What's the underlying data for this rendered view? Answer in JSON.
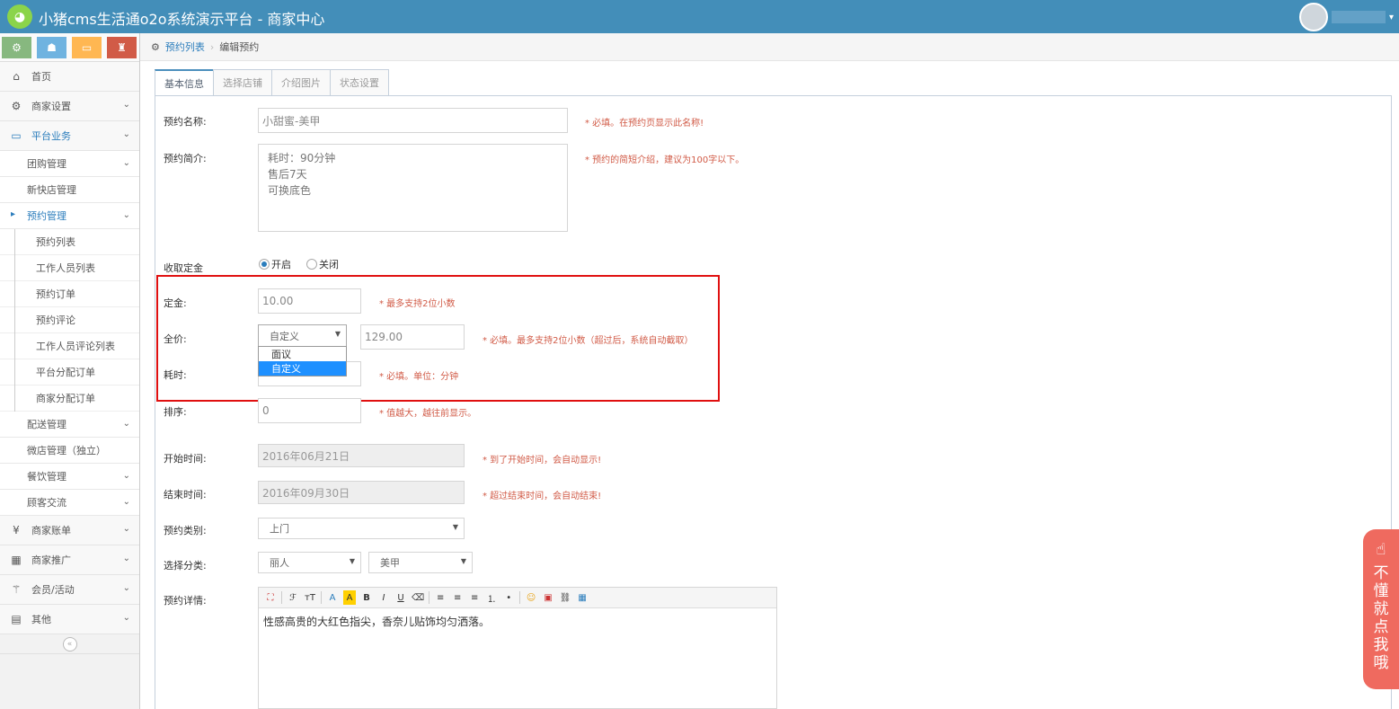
{
  "header": {
    "title": "小猪cms生活通o2o系统演示平台 - 商家中心",
    "user_caret": "▾"
  },
  "shortcuts": [
    {
      "icon": "gear-icon",
      "glyph": "⚙",
      "color": "#87b87f"
    },
    {
      "icon": "users-icon",
      "glyph": "☗",
      "color": "#6fb3e0"
    },
    {
      "icon": "monitor-icon",
      "glyph": "▭",
      "color": "#ffb752"
    },
    {
      "icon": "group-icon",
      "glyph": "♜",
      "color": "#d15b47"
    }
  ],
  "sidebar": {
    "home": "首页",
    "merchant_settings": "商家设置",
    "platform_business": "平台业务",
    "group_buy": "团购管理",
    "new_store": "新快店管理",
    "appointment": "预约管理",
    "appointment_sub": [
      "预约列表",
      "工作人员列表",
      "预约订单",
      "预约评论",
      "工作人员评论列表",
      "平台分配订单",
      "商家分配订单"
    ],
    "delivery": "配送管理",
    "micro_store": "微店管理（独立）",
    "catering": "餐饮管理",
    "customer": "顾客交流",
    "bills": "商家账单",
    "promotion": "商家推广",
    "members": "会员/活动",
    "other": "其他",
    "collapse": "«"
  },
  "breadcrumb": {
    "link": "预约列表",
    "sep": "›",
    "current": "编辑预约"
  },
  "tabs": [
    "基本信息",
    "选择店铺",
    "介绍图片",
    "状态设置"
  ],
  "form": {
    "name_label": "预约名称:",
    "name_value": "小甜蜜-美甲",
    "name_hint": "* 必填。在预约页显示此名称!",
    "intro_label": "预约简介:",
    "intro_value": "耗时：90分钟\n售后7天\n可换底色",
    "intro_hint": "* 预约的简短介绍，建议为100字以下。",
    "deposit_toggle_label": "收取定金",
    "radio_on": "开启",
    "radio_off": "关闭",
    "deposit_label": "定金:",
    "deposit_value": "10.00",
    "deposit_hint": "* 最多支持2位小数",
    "price_label": "全价:",
    "price_select": "自定义",
    "price_value": "129.00",
    "price_hint": "* 必填。最多支持2位小数（超过后，系统自动截取）",
    "price_options": [
      "面议",
      "自定义"
    ],
    "duration_label": "耗时:",
    "duration_hint": "* 必填。单位：分钟",
    "sort_label": "排序:",
    "sort_value": "0",
    "sort_hint": "* 值越大，越往前显示。",
    "start_label": "开始时间:",
    "start_value": "2016年06月21日",
    "start_hint": "* 到了开始时间，会自动显示!",
    "end_label": "结束时间:",
    "end_value": "2016年09月30日",
    "end_hint": "* 超过结束时间，会自动结束!",
    "type_label": "预约类别:",
    "type_value": "上门",
    "category_label": "选择分类:",
    "category_1": "丽人",
    "category_2": "美甲",
    "detail_label": "预约详情:",
    "detail_value": "性感高贵的大红色指尖，香奈儿贴饰均匀洒落。"
  },
  "editor_toolbar": [
    "⛶",
    "ℱ",
    "тT",
    "A",
    "A",
    "B",
    "I",
    "U",
    "⌫",
    "≡",
    "≡",
    "≡",
    "⒈",
    "•",
    "☺",
    "▣",
    "⛓",
    "▦"
  ],
  "help_float": {
    "icon": "☝",
    "text": "不懂就点我哦"
  }
}
